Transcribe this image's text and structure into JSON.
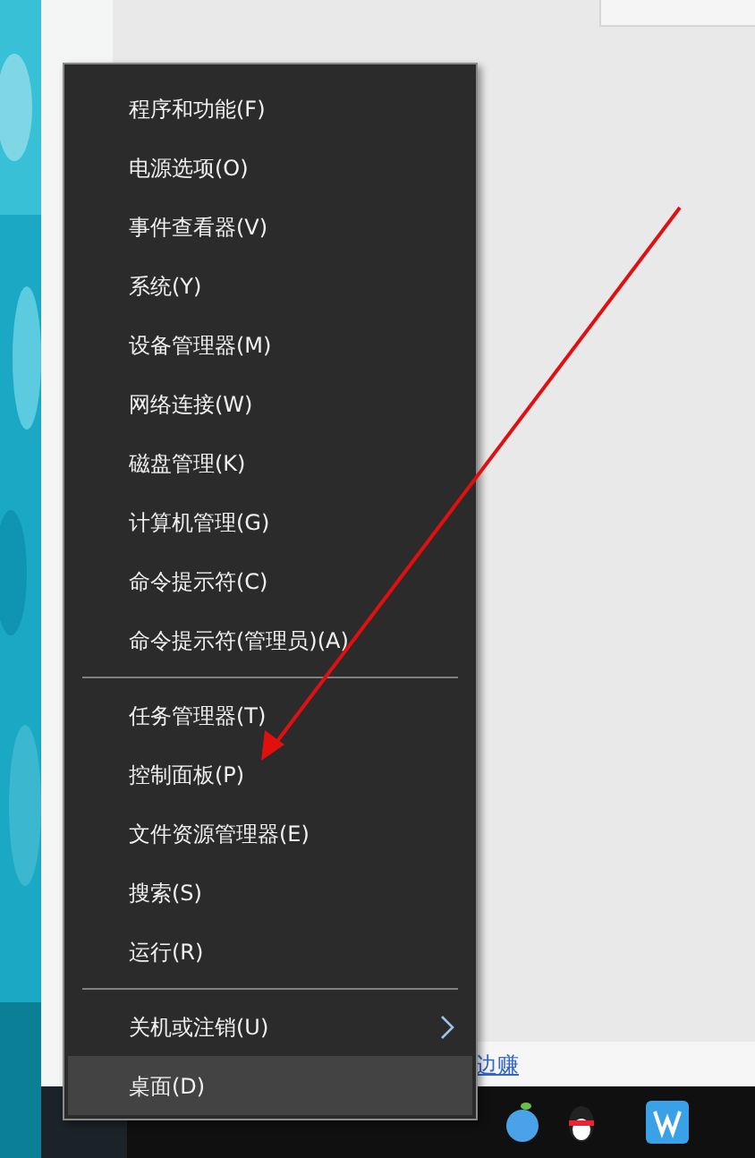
{
  "menu": {
    "groups": [
      {
        "items": [
          {
            "label": "程序和功能(F)",
            "selected": false,
            "submenu": false
          },
          {
            "label": "电源选项(O)",
            "selected": false,
            "submenu": false
          },
          {
            "label": "事件查看器(V)",
            "selected": false,
            "submenu": false
          },
          {
            "label": "系统(Y)",
            "selected": false,
            "submenu": false
          },
          {
            "label": "设备管理器(M)",
            "selected": false,
            "submenu": false
          },
          {
            "label": "网络连接(W)",
            "selected": false,
            "submenu": false
          },
          {
            "label": "磁盘管理(K)",
            "selected": false,
            "submenu": false
          },
          {
            "label": "计算机管理(G)",
            "selected": false,
            "submenu": false
          },
          {
            "label": "命令提示符(C)",
            "selected": false,
            "submenu": false
          },
          {
            "label": "命令提示符(管理员)(A)",
            "selected": false,
            "submenu": false
          }
        ]
      },
      {
        "items": [
          {
            "label": "任务管理器(T)",
            "selected": false,
            "submenu": false
          },
          {
            "label": "控制面板(P)",
            "selected": false,
            "submenu": false
          },
          {
            "label": "文件资源管理器(E)",
            "selected": false,
            "submenu": false
          },
          {
            "label": "搜索(S)",
            "selected": false,
            "submenu": false
          },
          {
            "label": "运行(R)",
            "selected": false,
            "submenu": false
          }
        ]
      },
      {
        "items": [
          {
            "label": "关机或注销(U)",
            "selected": false,
            "submenu": true
          },
          {
            "label": "桌面(D)",
            "selected": true,
            "submenu": false
          }
        ]
      }
    ]
  },
  "page_link": "边赚"
}
